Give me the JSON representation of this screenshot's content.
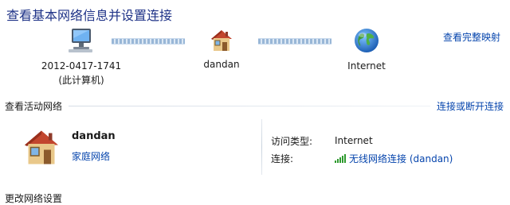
{
  "header": {
    "title": "查看基本网络信息并设置连接",
    "map_link": "查看完整映射"
  },
  "map": {
    "computer": {
      "name": "2012-0417-1741",
      "subtitle": "(此计算机)"
    },
    "network": {
      "name": "dandan"
    },
    "internet": {
      "name": "Internet"
    }
  },
  "active": {
    "header": "查看活动网络",
    "link": "连接或断开连接",
    "network_name": "dandan",
    "network_type": "家庭网络",
    "access_type_label": "访问类型:",
    "access_type_value": "Internet",
    "connection_label": "连接:",
    "connection_value": "无线网络连接 (dandan)"
  },
  "change": {
    "header": "更改网络设置"
  },
  "colors": {
    "title": "#1e3287",
    "link": "#0645ad"
  },
  "icons": {
    "computer": "computer-monitor-icon",
    "network": "home-network-icon",
    "internet": "globe-icon",
    "signal": "wireless-signal-icon"
  }
}
